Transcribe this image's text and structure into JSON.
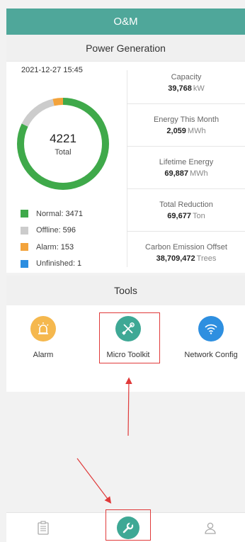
{
  "header": {
    "title": "O&M"
  },
  "power": {
    "title": "Power Generation",
    "date": "2021-12-27 15:45",
    "total_value": "4221",
    "total_label": "Total",
    "legend": [
      {
        "label": "Normal:",
        "value": "3471",
        "color": "#3fa94a",
        "count": 3471
      },
      {
        "label": "Offline:",
        "value": "596",
        "color": "#cccccc",
        "count": 596
      },
      {
        "label": "Alarm:",
        "value": "153",
        "color": "#f3a33b",
        "count": 153
      },
      {
        "label": "Unfinished:",
        "value": "1",
        "color": "#2b8de0",
        "count": 1
      }
    ],
    "stats": [
      {
        "label": "Capacity",
        "value": "39,768",
        "unit": "kW"
      },
      {
        "label": "Energy This Month",
        "value": "2,059",
        "unit": "MWh"
      },
      {
        "label": "Lifetime Energy",
        "value": "69,887",
        "unit": "MWh"
      },
      {
        "label": "Total Reduction",
        "value": "69,677",
        "unit": "Ton"
      },
      {
        "label": "Carbon Emission Offset",
        "value": "38,709,472",
        "unit": "Trees"
      }
    ]
  },
  "tools": {
    "title": "Tools",
    "items": [
      {
        "label": "Alarm",
        "icon": "alarm-light-icon",
        "color": "#f5b84e"
      },
      {
        "label": "Micro Toolkit",
        "icon": "tools-icon",
        "color": "#3ea895"
      },
      {
        "label": "Network Config",
        "icon": "wifi-icon",
        "color": "#2e8fe0"
      }
    ]
  },
  "tabbar": {
    "items": [
      {
        "icon": "clipboard-icon"
      },
      {
        "icon": "wrench-icon",
        "active": true
      },
      {
        "icon": "user-icon"
      }
    ]
  }
}
